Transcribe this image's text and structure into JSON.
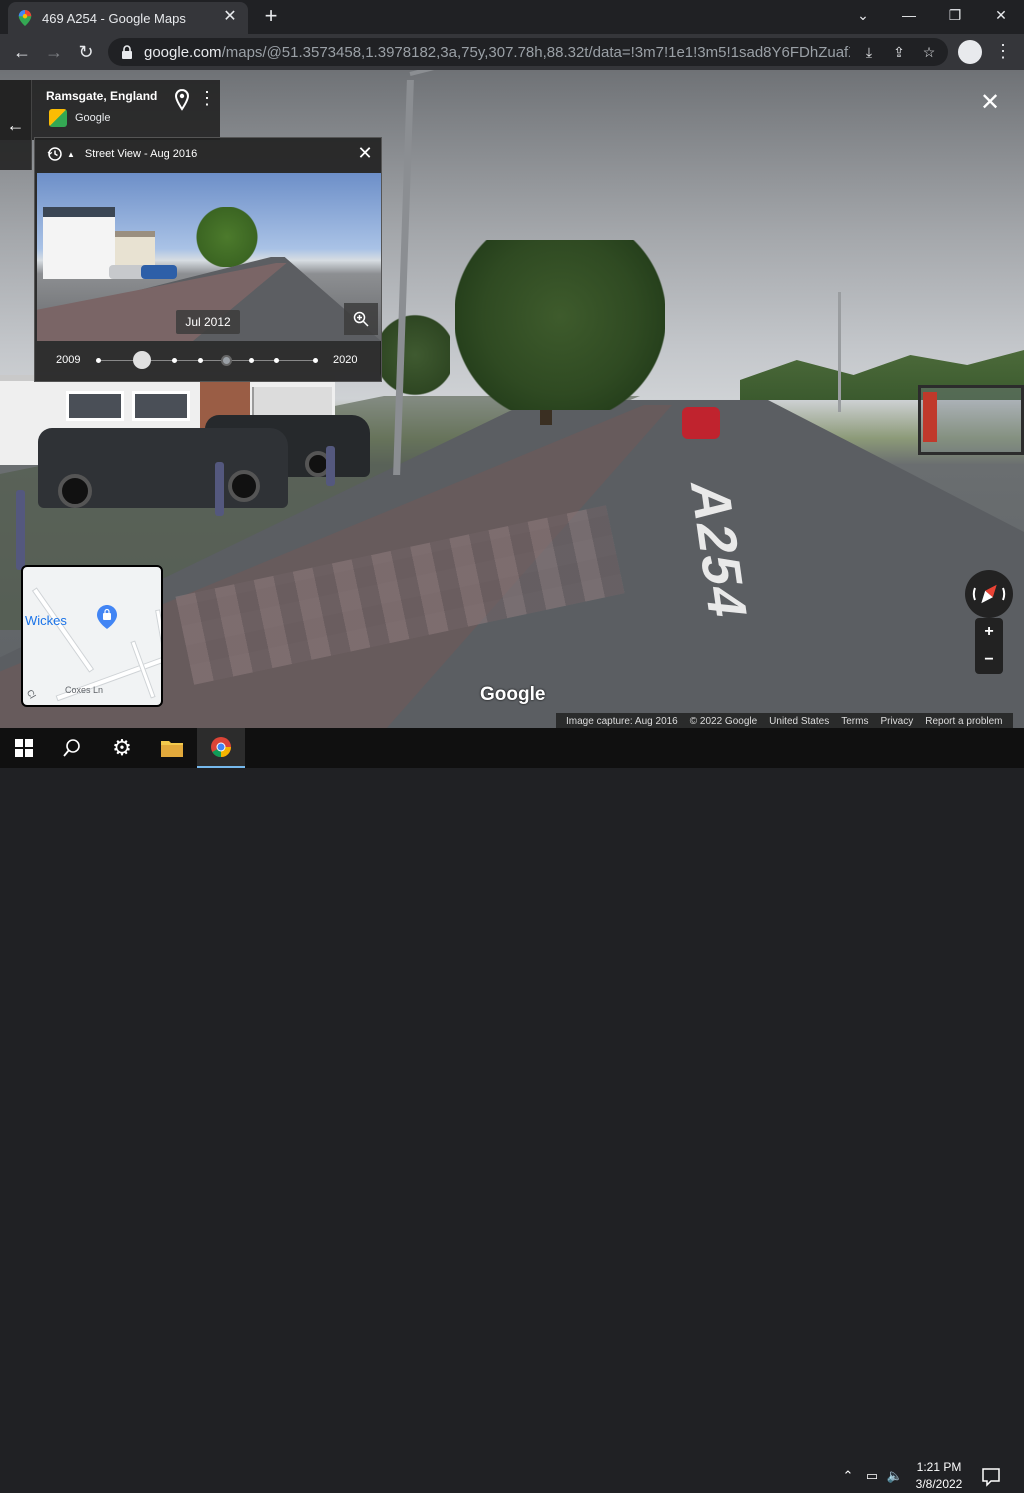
{
  "browser": {
    "tab_title": "469 A254 - Google Maps",
    "url_host": "google.com",
    "url_path": "/maps/@51.3573458,1.3978182,3a,75y,307.78h,88.32t/data=!3m7!1e1!3m5!1sad8Y6FDhZuafXAvChU...",
    "new_tab_label": "+",
    "tab_close_label": "✕"
  },
  "place_card": {
    "name": "Ramsgate, England",
    "source": "Google"
  },
  "timeline": {
    "title": "Street View - Aug 2016",
    "preview_date": "Jul 2012",
    "year_start": "2009",
    "year_end": "2020",
    "close_label": "✕"
  },
  "scene": {
    "road_marking": "A254"
  },
  "minimap": {
    "place_label": "Wickes",
    "street_label": "Coxes Ln",
    "street_label_2": "Cl"
  },
  "controls": {
    "zoom_in": "+",
    "zoom_out": "−",
    "close_label": "✕"
  },
  "footer": {
    "wordmark": "Google",
    "image_capture": "Image capture: Aug 2016",
    "copyright": "© 2022 Google",
    "region": "United States",
    "terms": "Terms",
    "privacy": "Privacy",
    "report": "Report a problem"
  },
  "taskbar": {
    "time": "1:21 PM",
    "date": "3/8/2022"
  },
  "colors": {
    "chrome_dark": "#202124",
    "chrome_toolbar": "#35363a",
    "overlay_panel": "#222222",
    "taskbar": "#101010",
    "accent_blue": "#1a73e8"
  }
}
